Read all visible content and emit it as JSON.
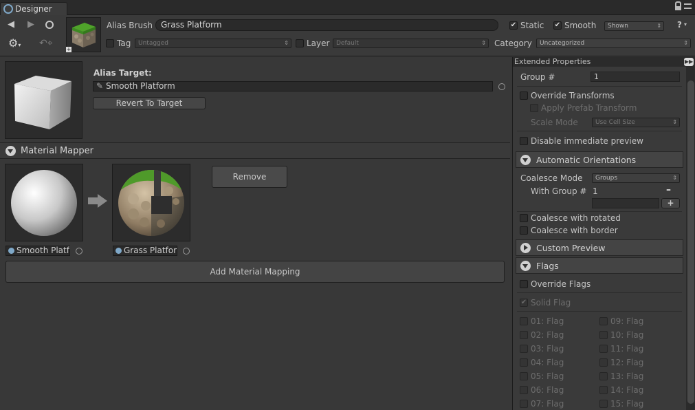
{
  "window": {
    "tab_title": "Designer"
  },
  "header": {
    "alias_brush_label": "Alias Brush",
    "brush_name": "Grass Platform",
    "static_label": "Static",
    "static_checked": true,
    "smooth_label": "Smooth",
    "smooth_checked": true,
    "visibility_value": "Shown",
    "help_label": "?",
    "tag_label": "Tag",
    "tag_value": "Untagged",
    "layer_label": "Layer",
    "layer_value": "Default",
    "category_label": "Category",
    "category_value": "Uncategorized",
    "icons": [
      "back-arrow-icon",
      "forward-arrow-icon",
      "locate-icon",
      "gear-icon",
      "goto-target-icon",
      "lock-icon",
      "tab-menu-icon"
    ]
  },
  "alias": {
    "target_label": "Alias Target:",
    "target_value": "Smooth Platform",
    "revert_label": "Revert To Target"
  },
  "material_mapper": {
    "title": "Material Mapper",
    "source_material": "Smooth Platfo",
    "target_material": "Grass Platform",
    "remove_label": "Remove",
    "add_label": "Add Material Mapping"
  },
  "extended": {
    "title": "Extended Properties",
    "group_label": "Group #",
    "group_value": "1",
    "override_transforms": "Override Transforms",
    "apply_prefab": "Apply Prefab Transform",
    "scale_mode_label": "Scale Mode",
    "scale_mode_value": "Use Cell Size",
    "disable_preview": "Disable immediate preview",
    "auto_orient_title": "Automatic Orientations",
    "coalesce_mode_label": "Coalesce Mode",
    "coalesce_mode_value": "Groups",
    "with_group_label": "With Group #",
    "with_group_value": "1",
    "minus_label": "–",
    "plus_label": "+",
    "coalesce_rotated": "Coalesce with rotated",
    "coalesce_border": "Coalesce with border",
    "custom_preview_title": "Custom Preview",
    "flags_title": "Flags",
    "override_flags": "Override Flags",
    "solid_flag": "Solid Flag",
    "flags_left": [
      "01: Flag",
      "02: Flag",
      "03: Flag",
      "04: Flag",
      "05: Flag",
      "06: Flag",
      "07: Flag"
    ],
    "flags_right": [
      "09: Flag",
      "10: Flag",
      "11: Flag",
      "12: Flag",
      "13: Flag",
      "14: Flag",
      "15: Flag"
    ]
  },
  "colors": {
    "background": "#383838",
    "field": "#2a2a2a",
    "accent_text": "#c4c4c4"
  }
}
